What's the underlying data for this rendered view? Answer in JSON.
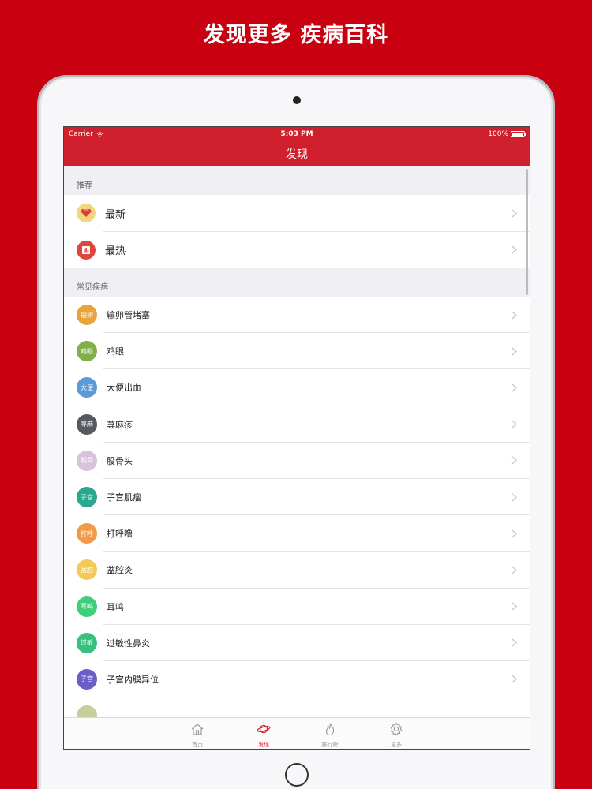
{
  "promo": {
    "title": "发现更多 疾病百科"
  },
  "status_bar": {
    "carrier": "Carrier",
    "time": "5:03 PM",
    "battery": "100%"
  },
  "nav": {
    "title": "发现"
  },
  "recommend": {
    "header": "推荐",
    "items": [
      {
        "label": "最新",
        "icon": "gem-icon",
        "color": "#f4d67c"
      },
      {
        "label": "最热",
        "icon": "bar-chart-icon",
        "color": "#e0453e"
      }
    ]
  },
  "common": {
    "header": "常见疾病",
    "items": [
      {
        "abbr": "输卵",
        "label": "输卵管堵塞",
        "color": "#e8a33a"
      },
      {
        "abbr": "鸡眼",
        "label": "鸡眼",
        "color": "#7fb04a"
      },
      {
        "abbr": "大便",
        "label": "大便出血",
        "color": "#5b9ad6"
      },
      {
        "abbr": "荨麻",
        "label": "荨麻疹",
        "color": "#555a60"
      },
      {
        "abbr": "股骨",
        "label": "股骨头",
        "color": "#d9c2dd"
      },
      {
        "abbr": "子宫",
        "label": "子宫肌瘤",
        "color": "#2aa88f"
      },
      {
        "abbr": "打呼",
        "label": "打呼噜",
        "color": "#f19a47"
      },
      {
        "abbr": "盆腔",
        "label": "盆腔炎",
        "color": "#f3c957"
      },
      {
        "abbr": "耳鸣",
        "label": "耳鸣",
        "color": "#3fcf7a"
      },
      {
        "abbr": "过敏",
        "label": "过敏性鼻炎",
        "color": "#36c27e"
      },
      {
        "abbr": "子宫",
        "label": "子宫内膜异位",
        "color": "#6a5fc8"
      },
      {
        "abbr": "",
        "label": "",
        "color": "#c5cf9a"
      }
    ]
  },
  "tabs": [
    {
      "label": "首页",
      "icon": "home-icon",
      "active": false
    },
    {
      "label": "发现",
      "icon": "planet-icon",
      "active": true
    },
    {
      "label": "排行榜",
      "icon": "flame-icon",
      "active": false
    },
    {
      "label": "更多",
      "icon": "gear-icon",
      "active": false
    }
  ],
  "colors": {
    "brand": "#d0202d",
    "background": "#c8000f"
  }
}
